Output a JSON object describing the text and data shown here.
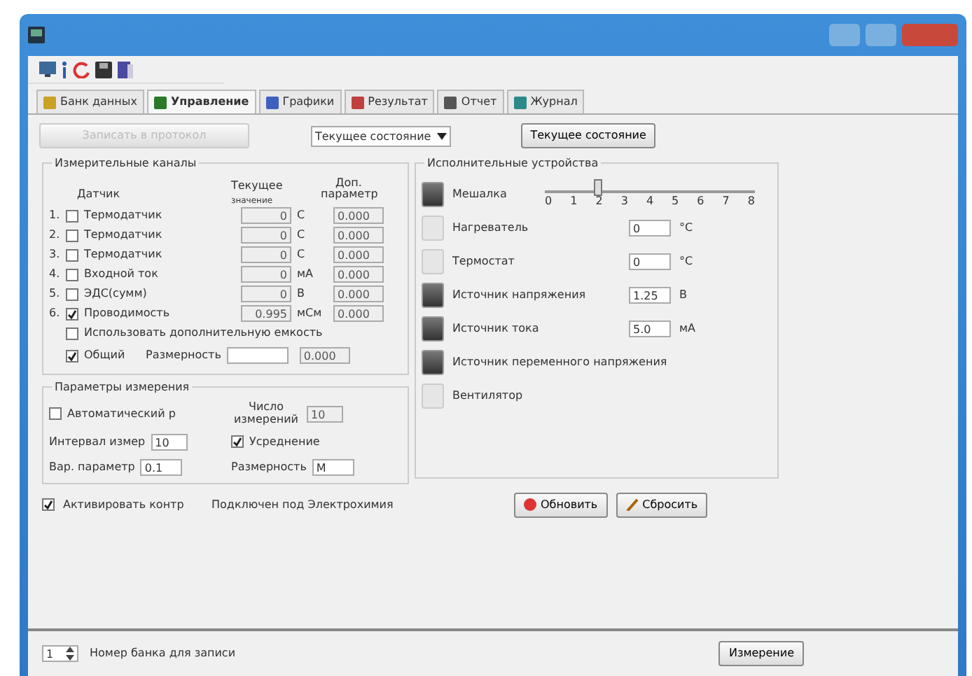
{
  "tabs": [
    {
      "label": "Банк данных",
      "selected": false
    },
    {
      "label": "Управление",
      "selected": true
    },
    {
      "label": "Графики",
      "selected": false
    },
    {
      "label": "Результат",
      "selected": false
    },
    {
      "label": "Отчет",
      "selected": false
    },
    {
      "label": "Журнал",
      "selected": false
    }
  ],
  "top_controls": {
    "disabled_button": {
      "label": "Записать в протокол",
      "disabled": true
    },
    "state_select": "Текущее состояние",
    "state_button": "Текущее состояние"
  },
  "channels": {
    "title": "Измерительные каналы",
    "col_sensor": "Датчик",
    "col_current": "Текущее",
    "col_current_sub": "значение",
    "col_extra": "Доп. параметр",
    "rows": [
      {
        "index": "1.",
        "name": "Термодатчик",
        "checked": false,
        "value": "0",
        "unit": "C",
        "extra": "0.000"
      },
      {
        "index": "2.",
        "name": "Термодатчик",
        "checked": false,
        "value": "0",
        "unit": "C",
        "extra": "0.000"
      },
      {
        "index": "3.",
        "name": "Термодатчик",
        "checked": false,
        "value": "0",
        "unit": "C",
        "extra": "0.000"
      },
      {
        "index": "4.",
        "name": "Входной ток",
        "checked": false,
        "value": "0",
        "unit": "мА",
        "extra": "0.000"
      },
      {
        "index": "5.",
        "name": "ЭДС(сумм)",
        "checked": false,
        "value": "0",
        "unit": "В",
        "extra": "0.000"
      },
      {
        "index": "6.",
        "name": "Проводимость",
        "checked": true,
        "value": "0.995",
        "unit": "мСм",
        "extra": "0.000"
      }
    ],
    "use_extra": {
      "label": "Использовать дополнительную емкость",
      "checked": false
    },
    "common": {
      "label": "Общий",
      "checked": true,
      "dim_label": "Размерность",
      "extra": "0.000"
    }
  },
  "params": {
    "title": "Параметры измерения",
    "auto": {
      "label": "Автоматический р",
      "checked": false
    },
    "count_label": "Число измерений",
    "count": "10",
    "interval_label": "Интервал измер",
    "interval": "10",
    "avg": {
      "label": "Усреднение",
      "checked": true
    },
    "var_label": "Вар. параметр",
    "var": "0.1",
    "dim_label": "Размерность",
    "dim": "M"
  },
  "actuators": {
    "title": "Исполнительные устройства",
    "items": [
      {
        "kind": "slider",
        "name": "Мешалка",
        "on": true,
        "ticks": [
          "0",
          "1",
          "2",
          "3",
          "4",
          "5",
          "6",
          "7",
          "8"
        ],
        "level": 0.25
      },
      {
        "kind": "field",
        "name": "Нагреватель",
        "on": false,
        "value": "0",
        "unit": "°C"
      },
      {
        "kind": "field",
        "name": "Термостат",
        "on": false,
        "value": "0",
        "unit": "°C"
      },
      {
        "kind": "field",
        "name": "Источник напряжения",
        "on": true,
        "value": "1.25",
        "unit": "В"
      },
      {
        "kind": "field",
        "name": "Источник тока",
        "on": true,
        "value": "5.0",
        "unit": "мА"
      },
      {
        "kind": "plain",
        "name": "Источник переменного напряжения",
        "on": true
      },
      {
        "kind": "plain",
        "name": "Вентилятор",
        "on": false
      }
    ]
  },
  "activate": {
    "label": "Активировать контр",
    "checked": true
  },
  "connected": "Подключен под Электрохимия",
  "buttons": [
    "Обновить",
    "Сбросить"
  ],
  "footer": {
    "bank": "1",
    "bank_label": "Номер банка для записи",
    "measure": "Измерение"
  }
}
